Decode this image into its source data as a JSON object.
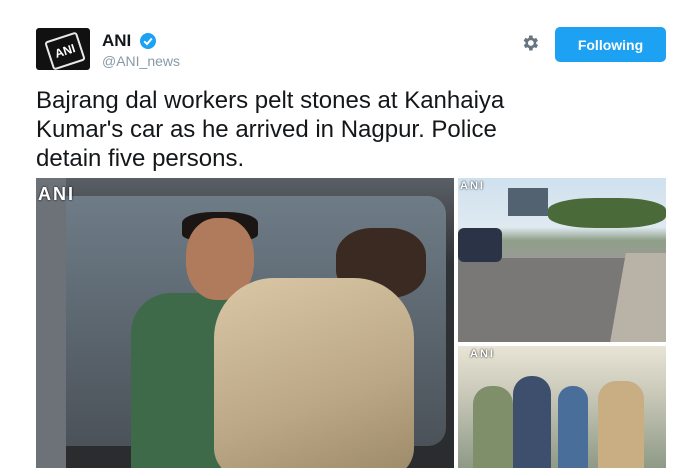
{
  "account": {
    "name": "ANI",
    "handle": "@ANI_news",
    "avatar_text": "ANI",
    "verified": true
  },
  "actions": {
    "follow_label": "Following",
    "settings_icon": "gear-icon"
  },
  "tweet": {
    "text_lines": [
      "Bajrang dal workers pelt stones at Kanhaiya",
      "Kumar's car as he arrived in Nagpur. Police",
      "detain five persons."
    ]
  },
  "media": {
    "watermarks": {
      "main": "ANI",
      "top_right": "ANI",
      "bottom_right": "ANI"
    }
  },
  "colors": {
    "accent": "#1da1f2",
    "text": "#14171a",
    "muted": "#8899a6"
  }
}
